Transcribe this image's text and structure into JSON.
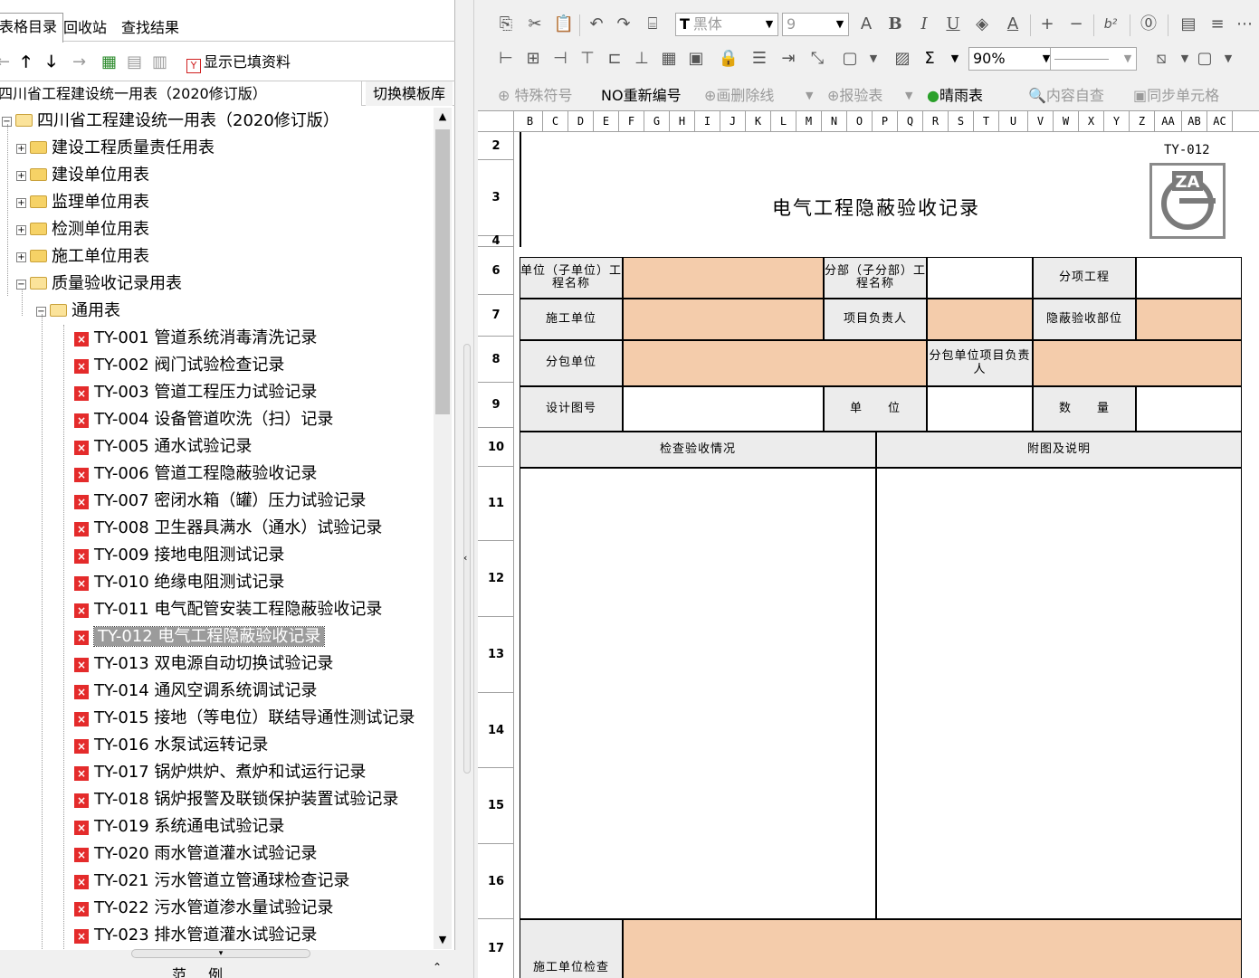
{
  "left_panel": {
    "tabs": [
      "表格目录",
      "回收站",
      "查找结果"
    ],
    "show_filled_label": "显示已填资料",
    "template_name": "四川省工程建设统一用表（2020修订版）",
    "switch_template_label": "切换模板库",
    "tree": {
      "root": "四川省工程建设统一用表（2020修订版）",
      "groups": [
        "建设工程质量责任用表",
        "建设单位用表",
        "监理单位用表",
        "检测单位用表",
        "施工单位用表",
        "质量验收记录用表"
      ],
      "subgroup": "通用表",
      "items": [
        "TY-001 管道系统消毒清洗记录",
        "TY-002 阀门试验检查记录",
        "TY-003 管道工程压力试验记录",
        "TY-004 设备管道吹洗（扫）记录",
        "TY-005 通水试验记录",
        "TY-006 管道工程隐蔽验收记录",
        "TY-007 密闭水箱（罐）压力试验记录",
        "TY-008 卫生器具满水（通水）试验记录",
        "TY-009 接地电阻测试记录",
        "TY-010 绝缘电阻测试记录",
        "TY-011 电气配管安装工程隐蔽验收记录",
        "TY-012 电气工程隐蔽验收记录",
        "TY-013 双电源自动切换试验记录",
        "TY-014 通风空调系统调试记录",
        "TY-015 接地（等电位）联结导通性测试记录",
        "TY-016 水泵试运转记录",
        "TY-017 锅炉烘炉、煮炉和试运行记录",
        "TY-018 锅炉报警及联锁保护装置试验记录",
        "TY-019 系统通电试验记录",
        "TY-020 雨水管道灌水试验记录",
        "TY-021 污水管道立管通球检查记录",
        "TY-022 污水管道渗水量试验记录",
        "TY-023 排水管道灌水试验记录"
      ],
      "selected_index": 11
    },
    "legend_label": "范例"
  },
  "toolbar": {
    "font_name": "黑体",
    "font_size": "9",
    "bold": "B",
    "italic": "I",
    "underline": "U",
    "superscript": "b²",
    "zoom": "90%",
    "special_symbol": "特殊符号",
    "renumber": "重新编号",
    "strike_line": "画删除线",
    "report_table": "报验表",
    "weather": "晴雨表",
    "content_check": "内容自查",
    "sync_cells": "同步单元格",
    "no_prefix": "NO",
    "sigma": "Σ"
  },
  "sheet": {
    "columns": [
      "B",
      "C",
      "D",
      "E",
      "F",
      "G",
      "H",
      "I",
      "J",
      "K",
      "L",
      "M",
      "N",
      "O",
      "P",
      "Q",
      "R",
      "S",
      "T",
      "U",
      "V",
      "W",
      "X",
      "Y",
      "Z",
      "AA",
      "AB",
      "AC"
    ],
    "rows": [
      "2",
      "3",
      "4",
      "6",
      "7",
      "8",
      "9",
      "10",
      "11",
      "12",
      "13",
      "14",
      "15",
      "16",
      "17"
    ],
    "code": "TY-012",
    "title": "电气工程隐蔽验收记录",
    "logo_text": "ZA",
    "labels": {
      "unit_name": "单位（子单位）工程名称",
      "sub_part_name": "分部（子分部）工程名称",
      "sub_item": "分项工程",
      "construction_unit": "施工单位",
      "project_leader": "项目负责人",
      "hidden_part": "隐蔽验收部位",
      "subcontractor": "分包单位",
      "sub_leader": "分包单位项目负责人",
      "design_no": "设计图号",
      "unit": "单　　位",
      "quantity": "数　　量",
      "inspection": "检查验收情况",
      "attachment": "附图及说明",
      "contractor_check": "施工单位检查"
    },
    "colors": {
      "peach": "#f4ccab",
      "gray": "#ececec"
    }
  }
}
